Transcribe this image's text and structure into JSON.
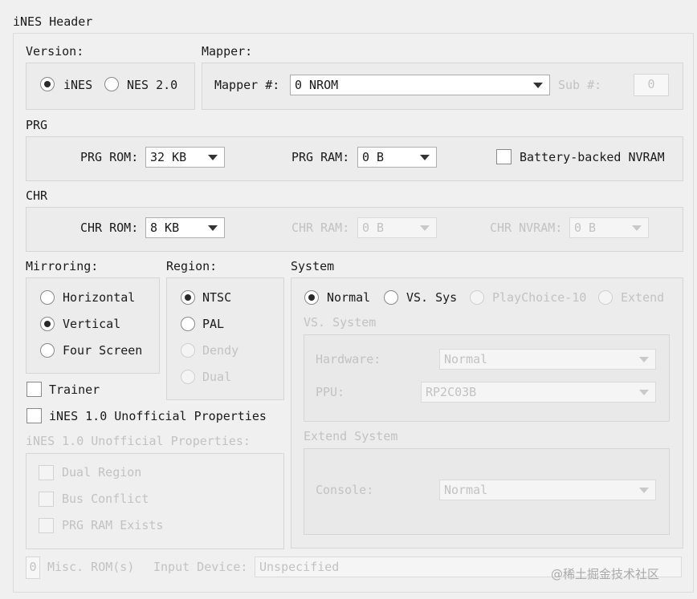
{
  "title": "iNES Header",
  "version": {
    "label": "Version:",
    "options": [
      "iNES",
      "NES 2.0"
    ],
    "selected": "iNES"
  },
  "mapper": {
    "label": "Mapper:",
    "mapper_num_label": "Mapper #:",
    "mapper_value": "0 NROM",
    "sub_label": "Sub #:",
    "sub_value": "0"
  },
  "prg": {
    "label": "PRG",
    "rom_label": "PRG ROM:",
    "rom_value": "32 KB",
    "ram_label": "PRG RAM:",
    "ram_value": "0 B",
    "battery_label": "Battery-backed NVRAM",
    "battery_checked": false
  },
  "chr": {
    "label": "CHR",
    "rom_label": "CHR ROM:",
    "rom_value": "8 KB",
    "ram_label": "CHR RAM:",
    "ram_value": "0 B",
    "nvram_label": "CHR NVRAM:",
    "nvram_value": "0 B"
  },
  "mirroring": {
    "label": "Mirroring:",
    "options": [
      "Horizontal",
      "Vertical",
      "Four Screen"
    ],
    "selected": "Vertical"
  },
  "region": {
    "label": "Region:",
    "options": [
      "NTSC",
      "PAL",
      "Dendy",
      "Dual"
    ],
    "selected": "NTSC"
  },
  "trainer_label": "Trainer",
  "ines10_label": "iNES 1.0 Unofficial Properties",
  "ines10_group": {
    "label": "iNES 1.0 Unofficial Properties:",
    "options": [
      "Dual Region",
      "Bus Conflict",
      "PRG RAM Exists"
    ]
  },
  "system": {
    "label": "System",
    "options": [
      "Normal",
      "VS. Sys",
      "PlayChoice-10",
      "Extend"
    ],
    "selected": "Normal",
    "vs_system": {
      "label": "VS. System",
      "hardware_label": "Hardware:",
      "hardware_value": "Normal",
      "ppu_label": "PPU:",
      "ppu_value": "RP2C03B"
    },
    "extend_system": {
      "label": "Extend System",
      "console_label": "Console:",
      "console_value": "Normal"
    }
  },
  "misc": {
    "misc_value": "0",
    "misc_label": "Misc. ROM(s)",
    "input_label": "Input Device:",
    "input_value": "Unspecified"
  },
  "watermark": "@稀土掘金技术社区"
}
